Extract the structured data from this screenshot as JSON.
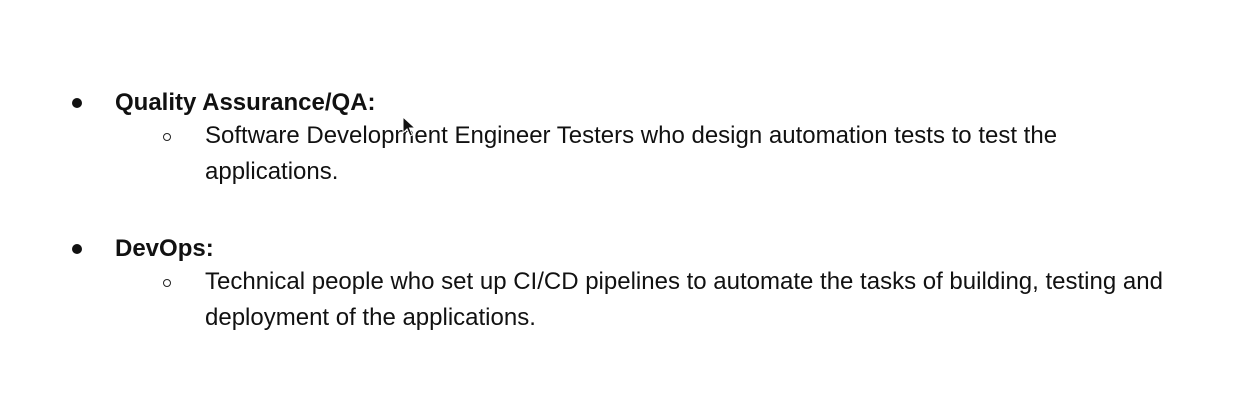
{
  "document": {
    "items": [
      {
        "heading": "Quality Assurance/QA:",
        "subitems": [
          "Software Development Engineer Testers who design automation tests to test the applications."
        ]
      },
      {
        "heading": "DevOps:",
        "subitems": [
          "Technical people who set up CI/CD pipelines to automate the tasks of building, testing and deployment of the applications."
        ]
      }
    ]
  },
  "icons": {
    "bullet": "filled-circle",
    "sub_bullet": "hollow-circle",
    "cursor": "mouse-pointer"
  },
  "colors": {
    "text": "#111111",
    "background": "#ffffff"
  }
}
